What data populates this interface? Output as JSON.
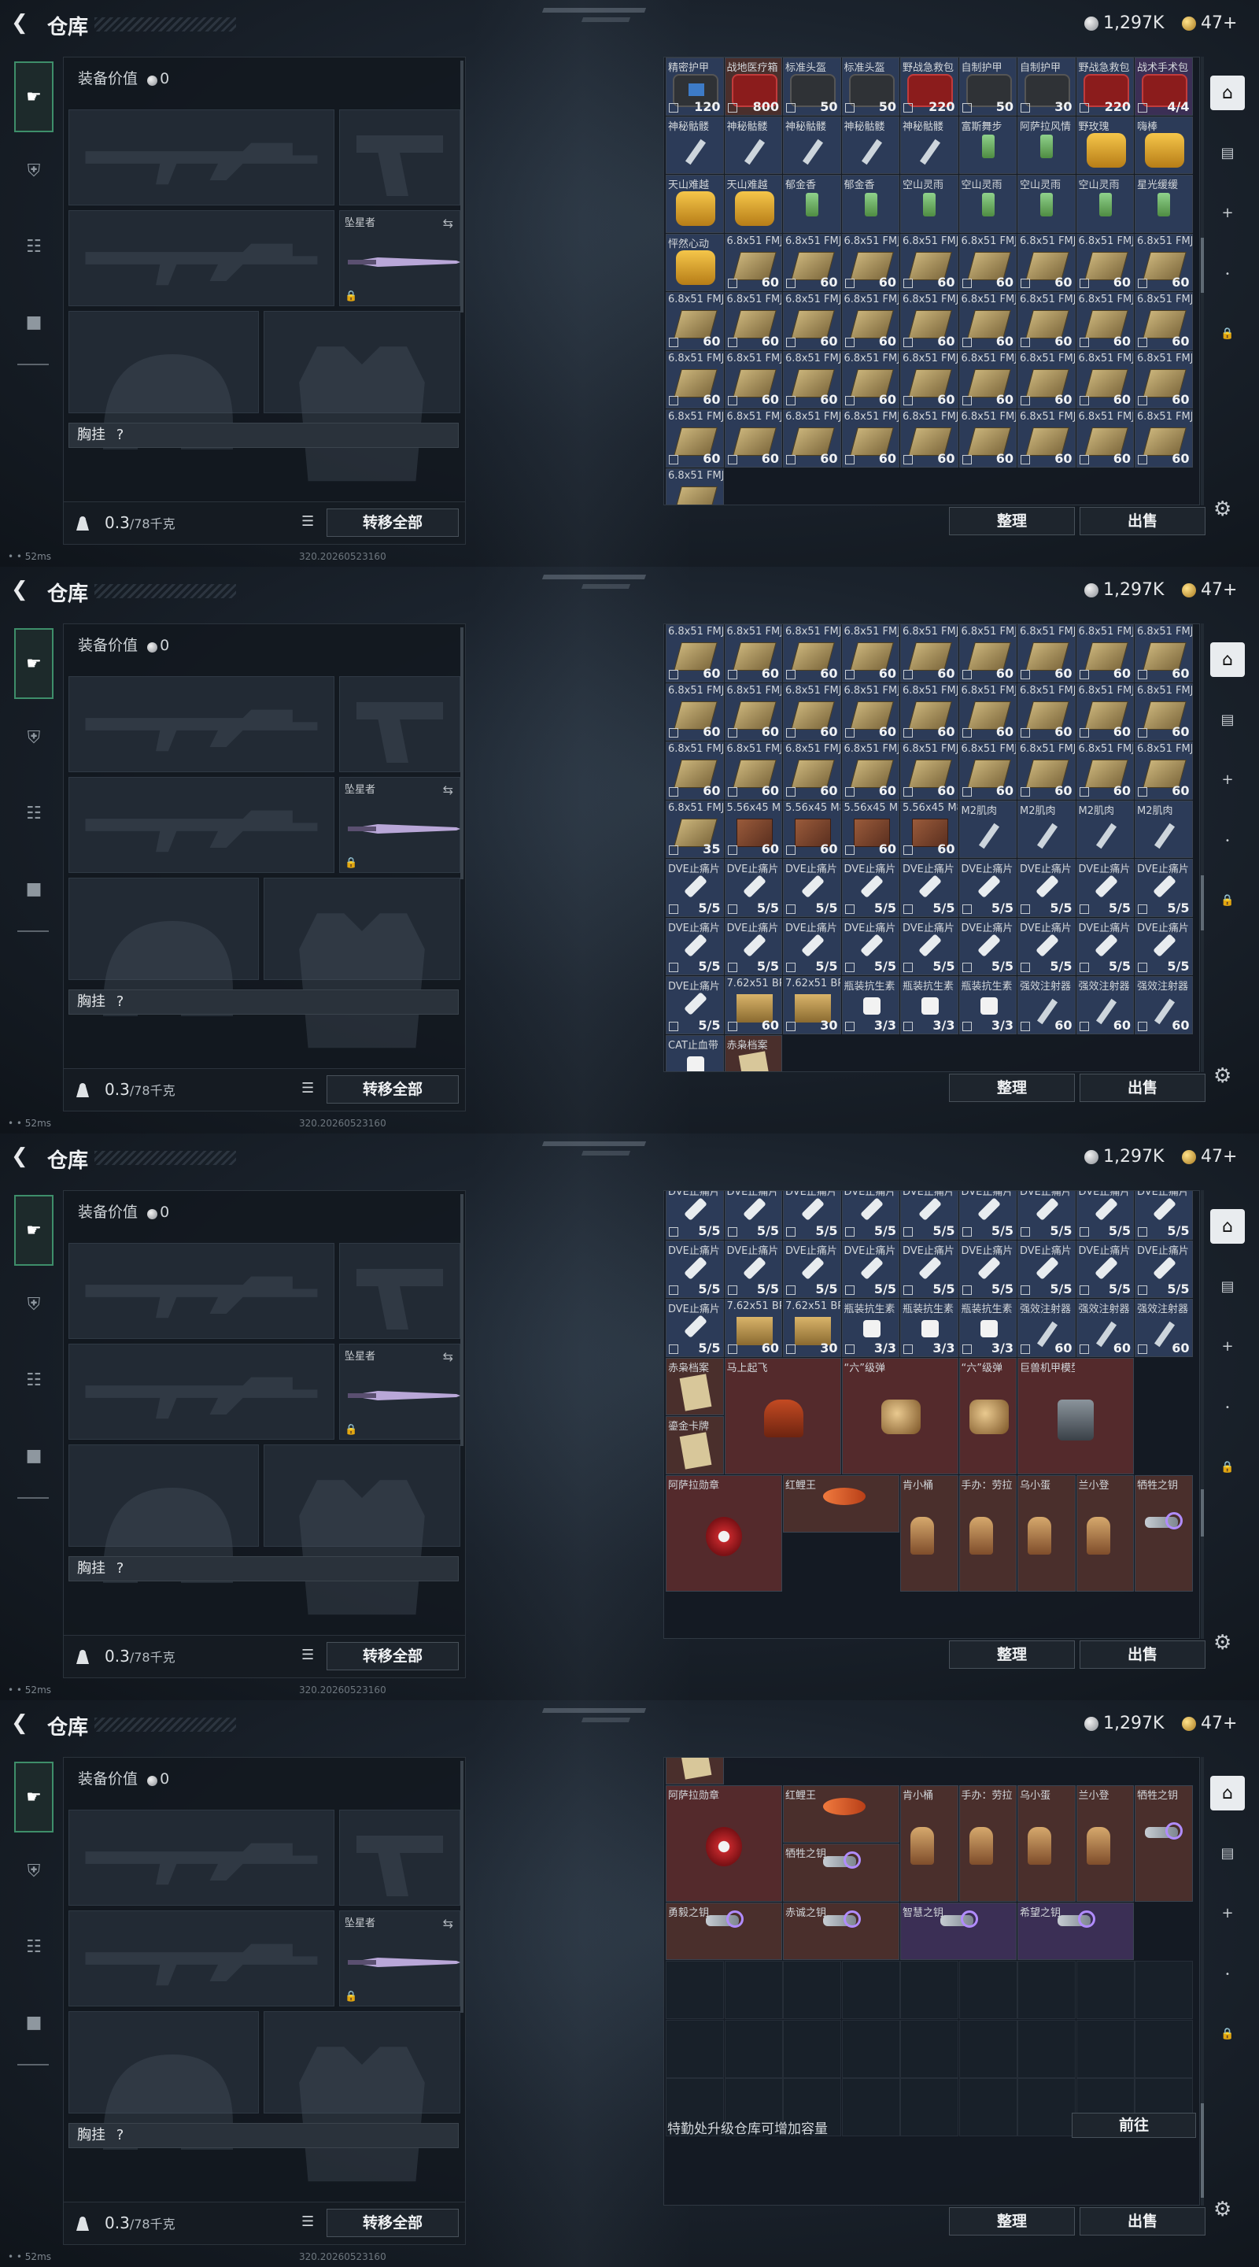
{
  "header": {
    "title": "仓库",
    "silver": "1,297K",
    "gold": "47+"
  },
  "loadout": {
    "equip_value_label": "装备价值",
    "equip_value": "0",
    "melee_name": "坠星者",
    "rig_label": "胸挂",
    "rig_hint": "?",
    "weight": "0.3",
    "weight_cap": "/78千克",
    "transfer_all": "转移全部"
  },
  "footer": {
    "ping": "52ms",
    "build": "320.20260523160"
  },
  "buttons": {
    "sort": "整理",
    "sell": "出售",
    "goto": "前往"
  },
  "upgrade_text": "特勤处升级仓库可增加容量",
  "icons": {
    "back": "back-arrow-icon",
    "silver": "silver-coin-icon",
    "gold": "gold-coin-icon",
    "weapon_tab": "gun-icon",
    "armor_tab": "armor-icon",
    "supply_tab": "clipboard-icon",
    "bag_tab": "briefcase-icon",
    "home": "home-icon",
    "stats": "chart-icon",
    "add": "plus-icon",
    "lock": "lock-icon",
    "settings": "gear-icon",
    "weight": "weight-icon",
    "list": "list-icon",
    "swap": "swap-icon"
  },
  "screens": [
    {
      "scroll_offset_rows": 0,
      "items": [
        {
          "n": "精密护甲",
          "c": "120",
          "art": "bag blue",
          "r": "r1"
        },
        {
          "n": "战地医疗箱",
          "c": "800",
          "art": "bag red",
          "r": "r3"
        },
        {
          "n": "标准头盔",
          "c": "50",
          "art": "bag",
          "r": "r1"
        },
        {
          "n": "标准头盔",
          "c": "50",
          "art": "bag",
          "r": "r1"
        },
        {
          "n": "野战急救包",
          "c": "220",
          "art": "bag red",
          "r": "r1"
        },
        {
          "n": "自制护甲",
          "c": "50",
          "art": "bag",
          "r": "r1"
        },
        {
          "n": "自制护甲",
          "c": "30",
          "art": "bag",
          "r": "r1"
        },
        {
          "n": "野战急救包",
          "c": "220",
          "art": "bag red",
          "r": "r1"
        },
        {
          "n": "战术手术包",
          "c": "4/4",
          "art": "bag red",
          "r": "r2"
        },
        {
          "n": "神秘骷髅",
          "c": "",
          "art": "syr",
          "r": "r1"
        },
        {
          "n": "神秘骷髅",
          "c": "",
          "art": "syr",
          "r": "r1"
        },
        {
          "n": "神秘骷髅",
          "c": "",
          "art": "syr",
          "r": "r1"
        },
        {
          "n": "神秘骷髅",
          "c": "",
          "art": "syr",
          "r": "r1"
        },
        {
          "n": "神秘骷髅",
          "c": "",
          "art": "syr",
          "r": "r1"
        },
        {
          "n": "富斯舞步",
          "c": "",
          "art": "drink",
          "r": "r1"
        },
        {
          "n": "阿萨拉风情",
          "c": "",
          "art": "drink",
          "r": "r1"
        },
        {
          "n": "野玫瑰",
          "c": "",
          "art": "drink gold",
          "r": "r1"
        },
        {
          "n": "嗨棒",
          "c": "",
          "art": "drink gold",
          "r": "r1"
        },
        {
          "n": "天山难越",
          "c": "",
          "art": "drink gold",
          "r": "r1"
        },
        {
          "n": "天山难越",
          "c": "",
          "art": "drink gold",
          "r": "r1"
        },
        {
          "n": "郁金香",
          "c": "",
          "art": "drink",
          "r": "r1"
        },
        {
          "n": "郁金香",
          "c": "",
          "art": "drink",
          "r": "r1"
        },
        {
          "n": "空山灵雨",
          "c": "",
          "art": "drink",
          "r": "r1"
        },
        {
          "n": "空山灵雨",
          "c": "",
          "art": "drink",
          "r": "r1"
        },
        {
          "n": "空山灵雨",
          "c": "",
          "art": "drink",
          "r": "r1"
        },
        {
          "n": "空山灵雨",
          "c": "",
          "art": "drink",
          "r": "r1"
        },
        {
          "n": "星光缓缓",
          "c": "",
          "art": "drink",
          "r": "r1"
        },
        {
          "n": "怦然心动",
          "c": "",
          "art": "drink gold",
          "r": "r1"
        },
        {
          "n": "6.8x51 FMJ",
          "c": "60",
          "art": "ammo",
          "r": "r1"
        },
        {
          "n": "6.8x51 FMJ",
          "c": "60",
          "art": "ammo",
          "r": "r1"
        },
        {
          "n": "6.8x51 FMJ",
          "c": "60",
          "art": "ammo",
          "r": "r1"
        },
        {
          "n": "6.8x51 FMJ",
          "c": "60",
          "art": "ammo",
          "r": "r1"
        },
        {
          "n": "6.8x51 FMJ",
          "c": "60",
          "art": "ammo",
          "r": "r1"
        },
        {
          "n": "6.8x51 FMJ",
          "c": "60",
          "art": "ammo",
          "r": "r1"
        },
        {
          "n": "6.8x51 FMJ",
          "c": "60",
          "art": "ammo",
          "r": "r1"
        },
        {
          "n": "6.8x51 FMJ",
          "c": "60",
          "art": "ammo",
          "r": "r1"
        },
        {
          "n": "6.8x51 FMJ",
          "c": "60",
          "art": "ammo",
          "r": "r1"
        },
        {
          "n": "6.8x51 FMJ",
          "c": "60",
          "art": "ammo",
          "r": "r1"
        },
        {
          "n": "6.8x51 FMJ",
          "c": "60",
          "art": "ammo",
          "r": "r1"
        },
        {
          "n": "6.8x51 FMJ",
          "c": "60",
          "art": "ammo",
          "r": "r1"
        },
        {
          "n": "6.8x51 FMJ",
          "c": "60",
          "art": "ammo",
          "r": "r1"
        },
        {
          "n": "6.8x51 FMJ",
          "c": "60",
          "art": "ammo",
          "r": "r1"
        },
        {
          "n": "6.8x51 FMJ",
          "c": "60",
          "art": "ammo",
          "r": "r1"
        },
        {
          "n": "6.8x51 FMJ",
          "c": "60",
          "art": "ammo",
          "r": "r1"
        },
        {
          "n": "6.8x51 FMJ",
          "c": "60",
          "art": "ammo",
          "r": "r1"
        },
        {
          "n": "6.8x51 FMJ",
          "c": "60",
          "art": "ammo",
          "r": "r1"
        },
        {
          "n": "6.8x51 FMJ",
          "c": "60",
          "art": "ammo",
          "r": "r1"
        },
        {
          "n": "6.8x51 FMJ",
          "c": "60",
          "art": "ammo",
          "r": "r1"
        },
        {
          "n": "6.8x51 FMJ",
          "c": "60",
          "art": "ammo",
          "r": "r1"
        },
        {
          "n": "6.8x51 FMJ",
          "c": "60",
          "art": "ammo",
          "r": "r1"
        },
        {
          "n": "6.8x51 FMJ",
          "c": "60",
          "art": "ammo",
          "r": "r1"
        },
        {
          "n": "6.8x51 FMJ",
          "c": "60",
          "art": "ammo",
          "r": "r1"
        },
        {
          "n": "6.8x51 FMJ",
          "c": "60",
          "art": "ammo",
          "r": "r1"
        },
        {
          "n": "6.8x51 FMJ",
          "c": "60",
          "art": "ammo",
          "r": "r1"
        },
        {
          "n": "6.8x51 FMJ",
          "c": "60",
          "art": "ammo",
          "r": "r1"
        },
        {
          "n": "6.8x51 FMJ",
          "c": "60",
          "art": "ammo",
          "r": "r1"
        },
        {
          "n": "6.8x51 FMJ",
          "c": "60",
          "art": "ammo",
          "r": "r1"
        },
        {
          "n": "6.8x51 FMJ",
          "c": "60",
          "art": "ammo",
          "r": "r1"
        }
      ]
    }
  ]
}
